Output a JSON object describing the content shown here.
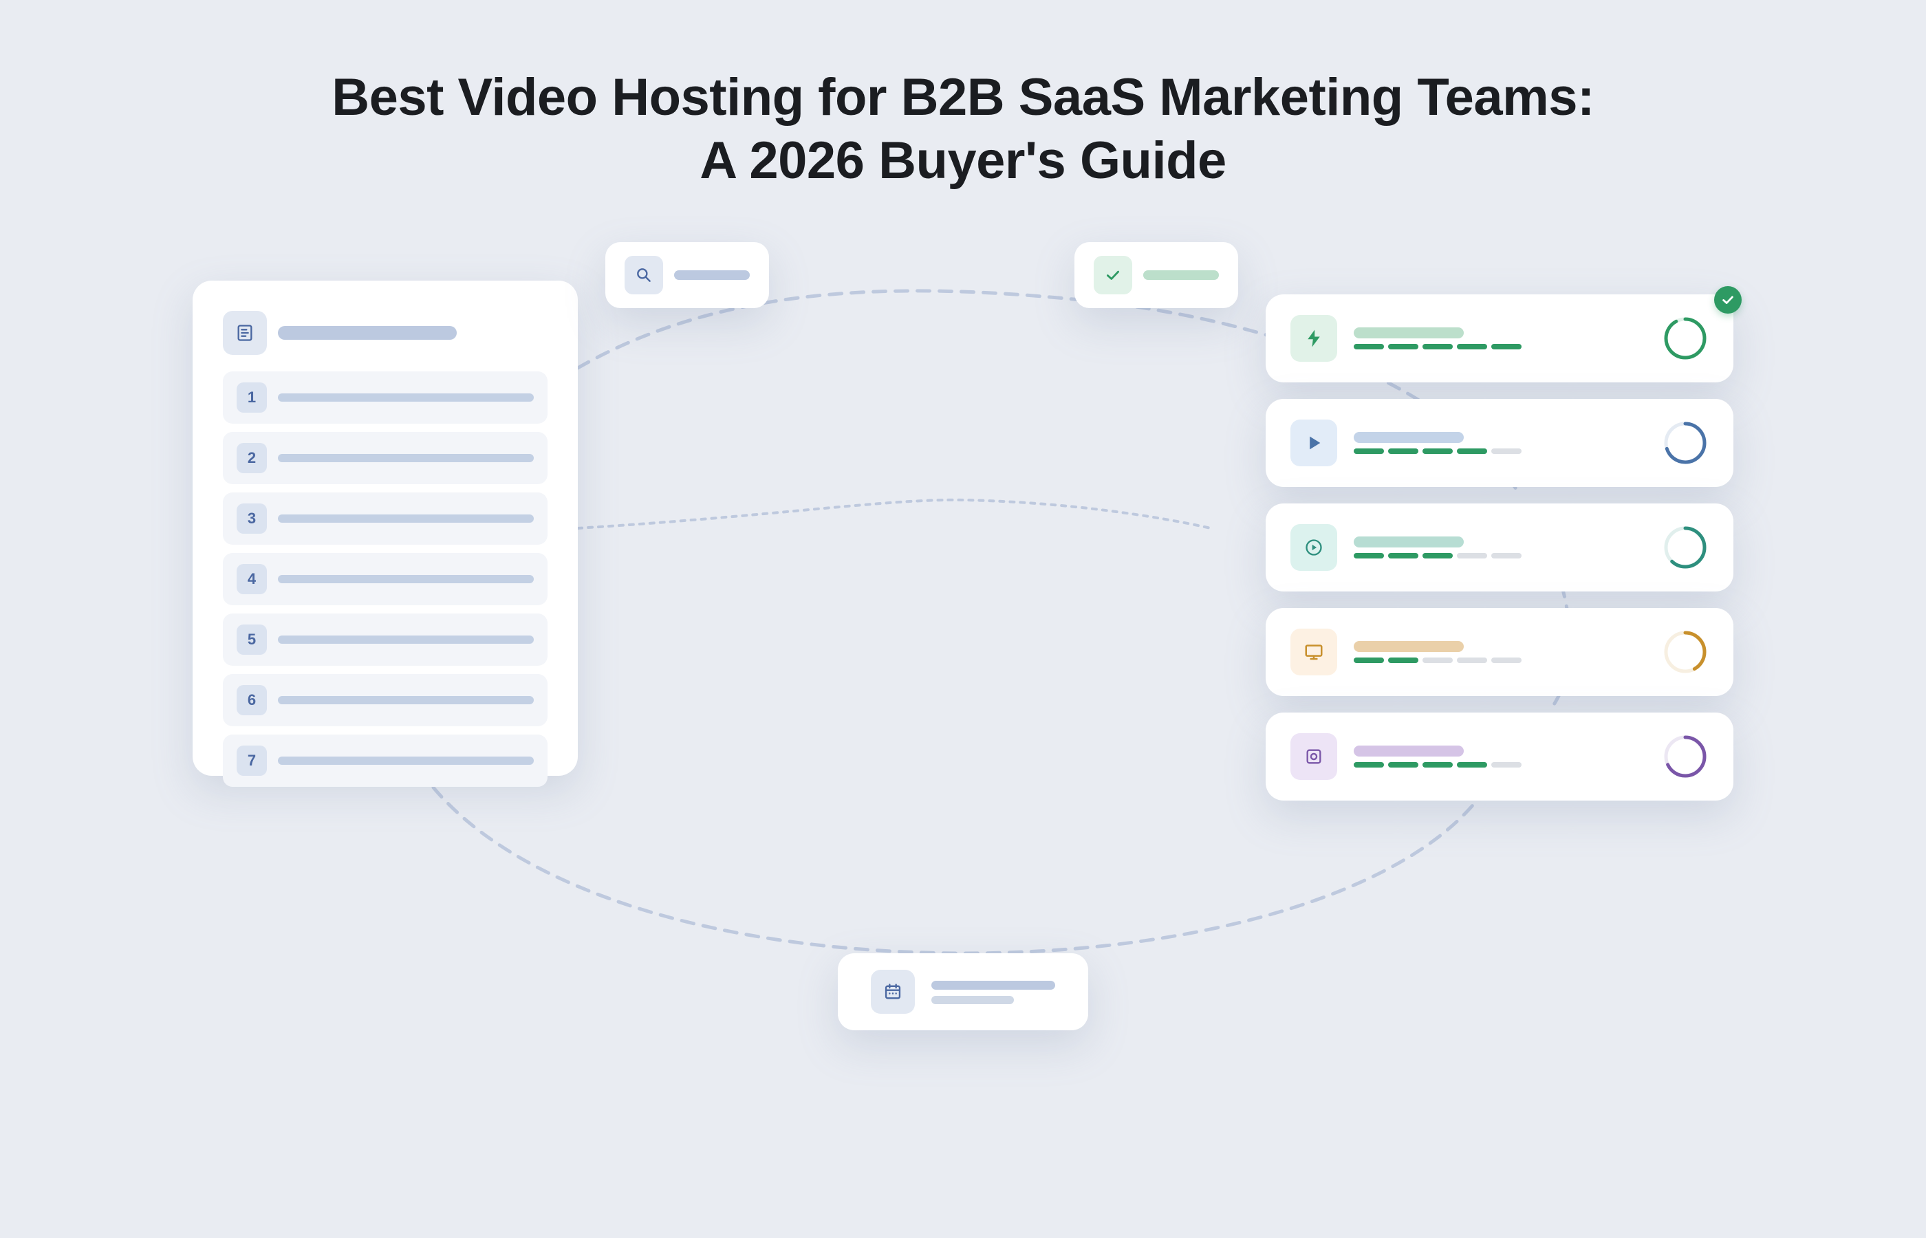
{
  "title": {
    "line1": "Best Video Hosting for B2B SaaS Marketing Teams:",
    "line2": "A 2026 Buyer's Guide"
  },
  "checklist": {
    "icon": "document-icon",
    "items": [
      "1",
      "2",
      "3",
      "4",
      "5",
      "6",
      "7"
    ]
  },
  "search_pill": {
    "icon": "search-icon",
    "color": "#4a67a1"
  },
  "check_pill": {
    "icon": "checkmark-icon",
    "color": "#2e9a63"
  },
  "calendar_card": {
    "icon": "calendar-icon",
    "color": "#4a67a1"
  },
  "platforms": [
    {
      "icon": "lightning-icon",
      "accent": "#2e9a63",
      "icon_bg": "#e1f2e8",
      "name_bar": "#bcdfcb",
      "rating": 5,
      "max": 5,
      "score": 0.92,
      "verified": true
    },
    {
      "icon": "play-icon",
      "accent": "#4a73a8",
      "icon_bg": "#e2ecf8",
      "name_bar": "#c3d3e8",
      "rating": 4,
      "max": 5,
      "score": 0.7,
      "verified": false
    },
    {
      "icon": "play-circle-icon",
      "accent": "#2e8f7e",
      "icon_bg": "#dcf2ee",
      "name_bar": "#b7ddd3",
      "rating": 3,
      "max": 5,
      "score": 0.62,
      "verified": false
    },
    {
      "icon": "monitor-icon",
      "accent": "#c8902c",
      "icon_bg": "#fdf1e3",
      "name_bar": "#ead0a9",
      "rating": 2,
      "max": 5,
      "score": 0.42,
      "verified": false
    },
    {
      "icon": "camera-icon",
      "accent": "#7a56a8",
      "icon_bg": "#ede4f6",
      "name_bar": "#d5c4e6",
      "rating": 4,
      "max": 5,
      "score": 0.68,
      "verified": false
    }
  ],
  "colors": {
    "background": "#e9ecf2",
    "connector": "#bec9de",
    "success": "#2e9a63"
  }
}
